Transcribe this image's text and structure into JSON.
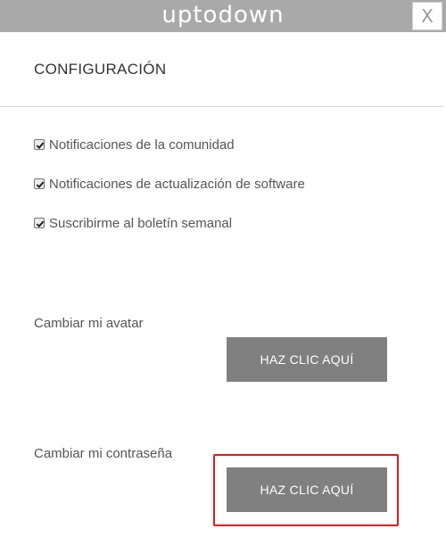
{
  "header": {
    "logo_text": "uptodown",
    "close_label": "X"
  },
  "page": {
    "title": "CONFIGURACIÓN"
  },
  "settings": {
    "checkboxes": [
      {
        "label": "Notificaciones de la comunidad",
        "checked": true
      },
      {
        "label": "Notificaciones de actualización de software",
        "checked": true
      },
      {
        "label": "Suscribirme al boletín semanal",
        "checked": true
      }
    ],
    "avatar": {
      "label": "Cambiar mi avatar",
      "button_label": "HAZ CLIC AQUÍ"
    },
    "password": {
      "label": "Cambiar mi contraseña",
      "button_label": "HAZ CLIC AQUÍ"
    }
  },
  "colors": {
    "topbar": "#a9a9a9",
    "button": "#808080",
    "highlight": "#e01b1b"
  }
}
